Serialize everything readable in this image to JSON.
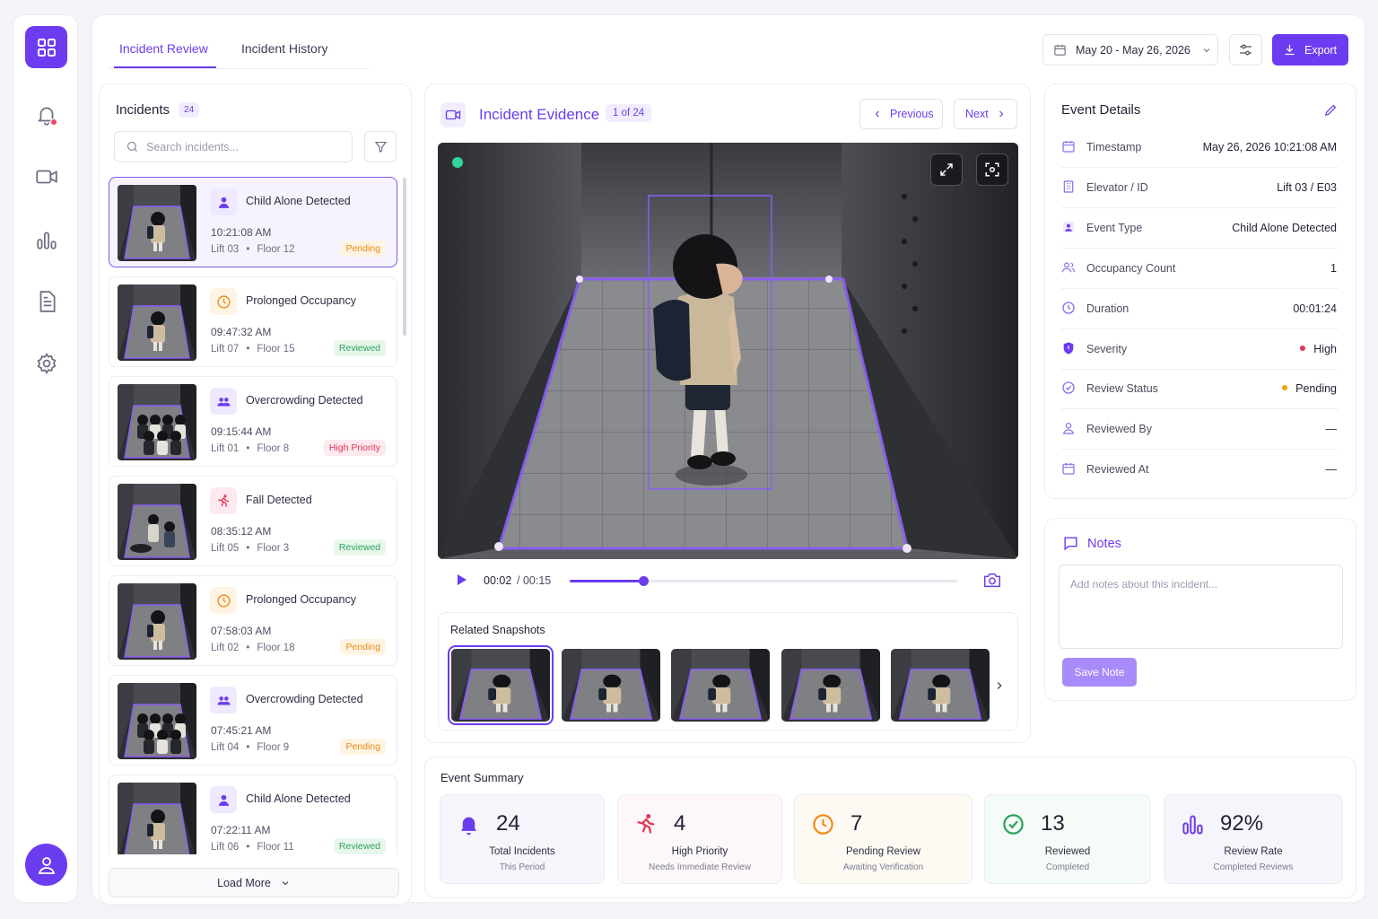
{
  "tabs": [
    {
      "label": "Incident Review",
      "active": true
    },
    {
      "label": "Incident History",
      "active": false
    }
  ],
  "header": {
    "date_range": "May 20 - May 26, 2026",
    "export_label": "Export"
  },
  "incidents": {
    "title": "Incidents",
    "count": "24",
    "search_placeholder": "Search incidents...",
    "load_more": "Load More",
    "items": [
      {
        "title": "Child Alone Detected",
        "time": "10:21:08 AM",
        "lift": "Lift 03",
        "floor": "Floor 12",
        "status": "Pending",
        "icon": "person-icon",
        "selected": true
      },
      {
        "title": "Prolonged Occupancy",
        "time": "09:47:32 AM",
        "lift": "Lift 07",
        "floor": "Floor 15",
        "status": "Reviewed",
        "icon": "clock-icon"
      },
      {
        "title": "Overcrowding Detected",
        "time": "09:15:44 AM",
        "lift": "Lift 01",
        "floor": "Floor 8",
        "status": "High Priority",
        "icon": "group-icon"
      },
      {
        "title": "Fall Detected",
        "time": "08:35:12 AM",
        "lift": "Lift 05",
        "floor": "Floor 3",
        "status": "Reviewed",
        "icon": "running-person-icon"
      },
      {
        "title": "Prolonged Occupancy",
        "time": "07:58:03 AM",
        "lift": "Lift 02",
        "floor": "Floor 18",
        "status": "Pending",
        "icon": "clock-icon"
      },
      {
        "title": "Overcrowding Detected",
        "time": "07:45:21 AM",
        "lift": "Lift 04",
        "floor": "Floor 9",
        "status": "Pending",
        "icon": "group-icon"
      },
      {
        "title": "Child Alone Detected",
        "time": "07:22:11 AM",
        "lift": "Lift 06",
        "floor": "Floor 11",
        "status": "Reviewed",
        "icon": "person-icon"
      }
    ]
  },
  "evidence": {
    "title": "Incident Evidence",
    "counter": "1 of 24",
    "previous_label": "Previous",
    "next_label": "Next",
    "current_time": "00:02",
    "duration": "/ 00:15",
    "progress": 0.19,
    "snapshots_title": "Related Snapshots",
    "snapshot_count": 5
  },
  "details": {
    "title": "Event Details",
    "rows": [
      {
        "label": "Timestamp",
        "value": "May 26, 2026  10:21:08 AM",
        "icon": "calendar-icon"
      },
      {
        "label": "Elevator / ID",
        "value": "Lift 03 / E03",
        "icon": "building-icon"
      },
      {
        "label": "Event Type",
        "value": "Child Alone Detected",
        "icon": "person-badge-icon"
      },
      {
        "label": "Occupancy Count",
        "value": "1",
        "icon": "users-icon"
      },
      {
        "label": "Duration",
        "value": "00:01:24",
        "icon": "clock-icon"
      },
      {
        "label": "Severity",
        "value": "High",
        "icon": "shield-icon",
        "dot": "#e23656"
      },
      {
        "label": "Review Status",
        "value": "Pending",
        "icon": "check-circle-icon",
        "dot": "#f59e0b"
      },
      {
        "label": "Reviewed By",
        "value": "—",
        "icon": "user-icon"
      },
      {
        "label": "Reviewed At",
        "value": "—",
        "icon": "calendar-icon"
      }
    ]
  },
  "notes": {
    "title": "Notes",
    "placeholder": "Add notes about this incident...",
    "save_label": "Save Note"
  },
  "summary": {
    "title": "Event Summary",
    "stats": [
      {
        "value": "24",
        "label": "Total Incidents",
        "sub": "This Period",
        "icon": "bell-icon",
        "color": "#6c3cf0",
        "bg": "#f6f5fb"
      },
      {
        "value": "4",
        "label": "High Priority",
        "sub": "Needs Immediate Review",
        "icon": "running-person-icon",
        "color": "#e23656",
        "bg": "#fdf7f9"
      },
      {
        "value": "7",
        "label": "Pending Review",
        "sub": "Awaiting Verification",
        "icon": "clock-icon",
        "color": "#f08c1a",
        "bg": "#fefaf3"
      },
      {
        "value": "13",
        "label": "Reviewed",
        "sub": "Completed",
        "icon": "check-circle-icon",
        "color": "#2ba35a",
        "bg": "#f5fbf6"
      },
      {
        "value": "92%",
        "label": "Review Rate",
        "sub": "Completed Reviews",
        "icon": "bar-chart-icon",
        "color": "#6c3cf0",
        "bg": "#f6f5fb"
      }
    ]
  }
}
